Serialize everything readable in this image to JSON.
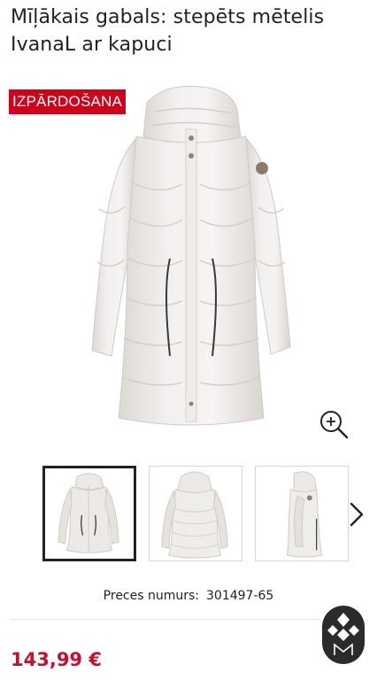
{
  "product": {
    "title": "Mīļākais gabals: stepēts mētelis IvanaL ar kapuci",
    "price": "143,99 €",
    "number_label": "Preces numurs:",
    "number_value": "301497-65"
  },
  "gallery": {
    "badge": "IZPĀRDOŠANA",
    "zoom_icon": "zoom-in-icon",
    "next_icon": "chevron-right-icon",
    "thumbnails": [
      "front view",
      "back view",
      "side view"
    ],
    "active_thumbnail": 0
  },
  "brand": {
    "badge_icon": "diamond-monogram-icon"
  },
  "colors": {
    "sale_red": "#d0021b",
    "price_red": "#c8102e",
    "text": "#222222",
    "coat": "#ece9e6"
  }
}
